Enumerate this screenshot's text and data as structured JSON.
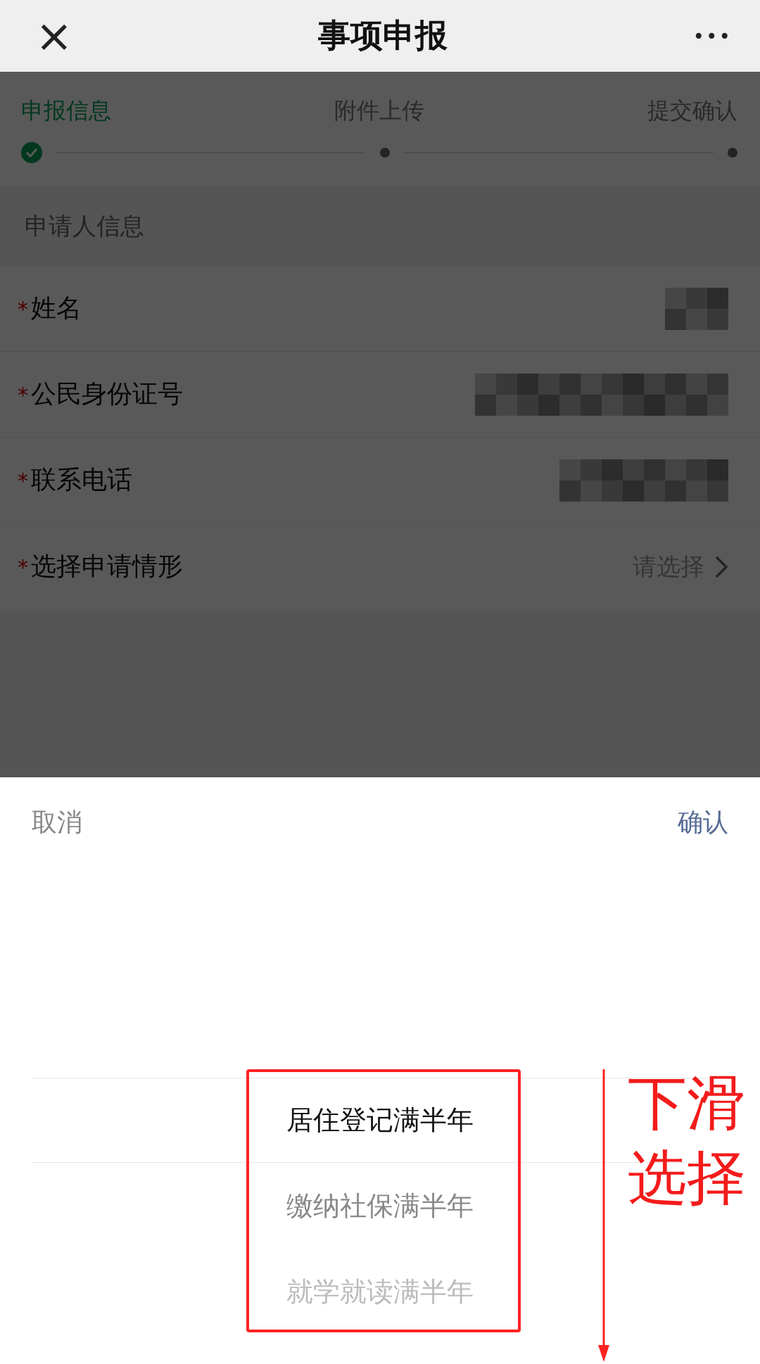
{
  "nav": {
    "close": "×",
    "title": "事项申报",
    "more": "•••"
  },
  "steps": [
    {
      "label": "申报信息",
      "done": true
    },
    {
      "label": "附件上传",
      "done": false
    },
    {
      "label": "提交确认",
      "done": false
    }
  ],
  "section": {
    "title": "申请人信息"
  },
  "fields": [
    {
      "required": "*",
      "label": "姓名",
      "kind": "blurred"
    },
    {
      "required": "*",
      "label": "公民身份证号",
      "kind": "blurred"
    },
    {
      "required": "*",
      "label": "联系电话",
      "kind": "blurred"
    }
  ],
  "choice": {
    "required": "*",
    "label": "选择申请情形",
    "placeholder": "请选择"
  },
  "sheet": {
    "cancel": "取消",
    "confirm": "确认",
    "options": [
      {
        "label": "居住登记满半年",
        "selected": true
      },
      {
        "label": "缴纳社保满半年",
        "selected": false
      },
      {
        "label": "就学就读满半年",
        "selected": false
      }
    ]
  },
  "annotation": {
    "lines": [
      "下滑",
      "选择"
    ]
  }
}
